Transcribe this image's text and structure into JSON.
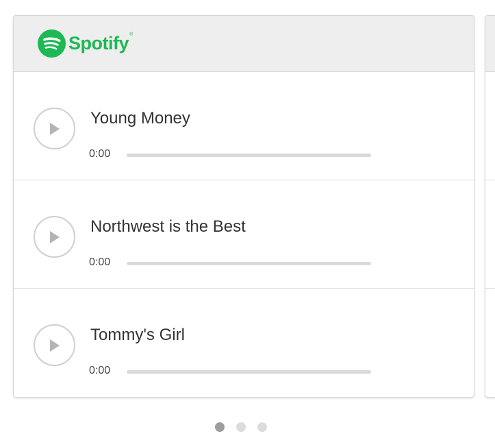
{
  "brand": {
    "name": "Spotify",
    "trademark": "®",
    "color": "#1db954",
    "icon": "spotify-logo-icon"
  },
  "tracks": [
    {
      "title": "Young Money",
      "time": "0:00",
      "progress": 0,
      "icon": "play-icon"
    },
    {
      "title": "Northwest is the Best",
      "time": "0:00",
      "progress": 0,
      "icon": "play-icon"
    },
    {
      "title": "Tommy's Girl",
      "time": "0:00",
      "progress": 0,
      "icon": "play-icon"
    }
  ],
  "pagination": {
    "pages": 3,
    "active_index": 0
  }
}
